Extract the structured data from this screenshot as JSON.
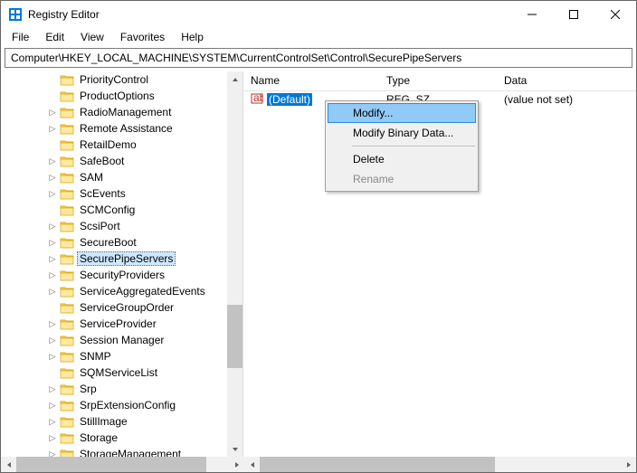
{
  "window": {
    "title": "Registry Editor"
  },
  "menu": {
    "file": "File",
    "edit": "Edit",
    "view": "View",
    "favorites": "Favorites",
    "help": "Help"
  },
  "address": "Computer\\HKEY_LOCAL_MACHINE\\SYSTEM\\CurrentControlSet\\Control\\SecurePipeServers",
  "columns": {
    "name": "Name",
    "type": "Type",
    "data": "Data"
  },
  "tree": {
    "items": [
      {
        "label": "PriorityControl",
        "expandable": false
      },
      {
        "label": "ProductOptions",
        "expandable": false
      },
      {
        "label": "RadioManagement",
        "expandable": true
      },
      {
        "label": "Remote Assistance",
        "expandable": true
      },
      {
        "label": "RetailDemo",
        "expandable": false
      },
      {
        "label": "SafeBoot",
        "expandable": true
      },
      {
        "label": "SAM",
        "expandable": true
      },
      {
        "label": "ScEvents",
        "expandable": true
      },
      {
        "label": "SCMConfig",
        "expandable": false
      },
      {
        "label": "ScsiPort",
        "expandable": true
      },
      {
        "label": "SecureBoot",
        "expandable": true
      },
      {
        "label": "SecurePipeServers",
        "expandable": true,
        "selected": true
      },
      {
        "label": "SecurityProviders",
        "expandable": true
      },
      {
        "label": "ServiceAggregatedEvents",
        "expandable": true
      },
      {
        "label": "ServiceGroupOrder",
        "expandable": false
      },
      {
        "label": "ServiceProvider",
        "expandable": true
      },
      {
        "label": "Session Manager",
        "expandable": true
      },
      {
        "label": "SNMP",
        "expandable": true
      },
      {
        "label": "SQMServiceList",
        "expandable": false
      },
      {
        "label": "Srp",
        "expandable": true
      },
      {
        "label": "SrpExtensionConfig",
        "expandable": true
      },
      {
        "label": "StillImage",
        "expandable": true
      },
      {
        "label": "Storage",
        "expandable": true
      },
      {
        "label": "StorageManagement",
        "expandable": true
      }
    ]
  },
  "values": [
    {
      "name": "(Default)",
      "type": "REG_SZ",
      "data": "(value not set)",
      "selected": true
    }
  ],
  "context_menu": {
    "modify": "Modify...",
    "modify_binary": "Modify Binary Data...",
    "delete": "Delete",
    "rename": "Rename"
  }
}
